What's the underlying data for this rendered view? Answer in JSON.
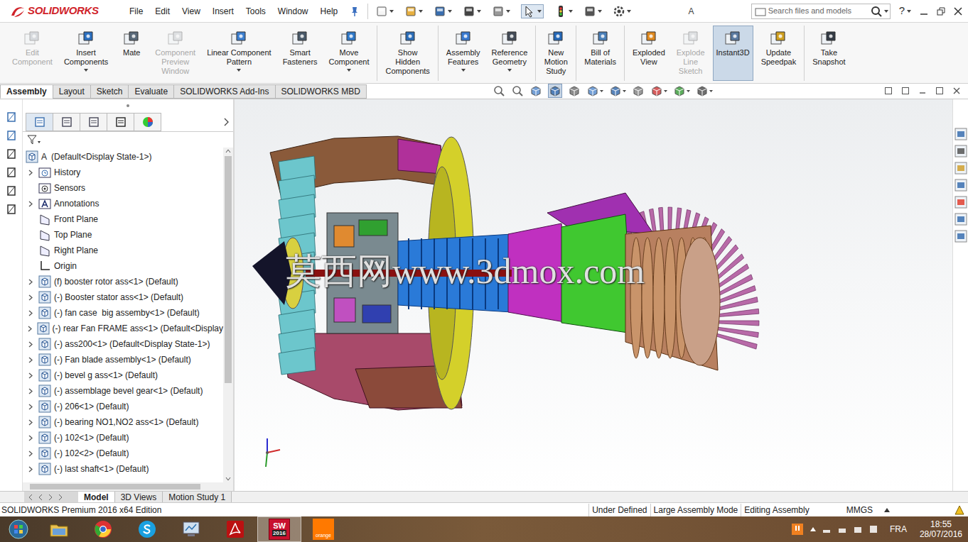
{
  "app": {
    "logo": "SOLIDWORKS",
    "document_title": "A",
    "help": "?"
  },
  "menu": [
    "File",
    "Edit",
    "View",
    "Insert",
    "Tools",
    "Window",
    "Help"
  ],
  "search": {
    "placeholder": "Search files and models"
  },
  "ribbon": [
    [
      {
        "lines": [
          "Edit",
          "Component"
        ],
        "disabled": true,
        "selected": false,
        "dropdown": false
      },
      {
        "lines": [
          "Insert",
          "Components"
        ],
        "disabled": false,
        "selected": false,
        "dropdown": true
      },
      {
        "lines": [
          "Mate"
        ],
        "disabled": false,
        "selected": false,
        "dropdown": false
      },
      {
        "lines": [
          "Component",
          "Preview",
          "Window"
        ],
        "disabled": true,
        "selected": false,
        "dropdown": false
      },
      {
        "lines": [
          "Linear Component",
          "Pattern"
        ],
        "disabled": false,
        "selected": false,
        "dropdown": true
      },
      {
        "lines": [
          "Smart",
          "Fasteners"
        ],
        "disabled": false,
        "selected": false,
        "dropdown": false
      },
      {
        "lines": [
          "Move",
          "Component"
        ],
        "disabled": false,
        "selected": false,
        "dropdown": true
      }
    ],
    [
      {
        "lines": [
          "Show",
          "Hidden",
          "Components"
        ],
        "disabled": false,
        "selected": false,
        "dropdown": false
      }
    ],
    [
      {
        "lines": [
          "Assembly",
          "Features"
        ],
        "disabled": false,
        "selected": false,
        "dropdown": true
      },
      {
        "lines": [
          "Reference",
          "Geometry"
        ],
        "disabled": false,
        "selected": false,
        "dropdown": true
      }
    ],
    [
      {
        "lines": [
          "New",
          "Motion",
          "Study"
        ],
        "disabled": false,
        "selected": false,
        "dropdown": false
      }
    ],
    [
      {
        "lines": [
          "Bill of",
          "Materials"
        ],
        "disabled": false,
        "selected": false,
        "dropdown": false
      }
    ],
    [
      {
        "lines": [
          "Exploded",
          "View"
        ],
        "disabled": false,
        "selected": false,
        "dropdown": false
      },
      {
        "lines": [
          "Explode",
          "Line",
          "Sketch"
        ],
        "disabled": true,
        "selected": false,
        "dropdown": false
      },
      {
        "lines": [
          "Instant3D"
        ],
        "disabled": false,
        "selected": true,
        "dropdown": false
      },
      {
        "lines": [
          "Update",
          "Speedpak"
        ],
        "disabled": false,
        "selected": false,
        "dropdown": false
      }
    ],
    [
      {
        "lines": [
          "Take",
          "Snapshot"
        ],
        "disabled": false,
        "selected": false,
        "dropdown": false
      }
    ]
  ],
  "command_tabs": [
    {
      "label": "Assembly",
      "selected": true
    },
    {
      "label": "Layout",
      "selected": false
    },
    {
      "label": "Sketch",
      "selected": false
    },
    {
      "label": "Evaluate",
      "selected": false
    },
    {
      "label": "SOLIDWORKS Add-Ins",
      "selected": false
    },
    {
      "label": "SOLIDWORKS MBD",
      "selected": false
    }
  ],
  "tree": {
    "root": "A  (Default<Display State-1>)",
    "items": [
      {
        "label": "History",
        "kind": "history",
        "expandable": true
      },
      {
        "label": "Sensors",
        "kind": "sensor",
        "expandable": false
      },
      {
        "label": "Annotations",
        "kind": "annotation",
        "expandable": true
      },
      {
        "label": "Front Plane",
        "kind": "plane",
        "expandable": false
      },
      {
        "label": "Top Plane",
        "kind": "plane",
        "expandable": false
      },
      {
        "label": "Right Plane",
        "kind": "plane",
        "expandable": false
      },
      {
        "label": "Origin",
        "kind": "origin",
        "expandable": false
      },
      {
        "label": "(f) booster rotor ass<1> (Default)",
        "kind": "assembly",
        "expandable": true
      },
      {
        "label": "(-) Booster stator ass<1> (Default)",
        "kind": "assembly",
        "expandable": true
      },
      {
        "label": "(-) fan case  big assemby<1> (Default)",
        "kind": "assembly",
        "expandable": true
      },
      {
        "label": "(-) rear Fan FRAME ass<1> (Default<Display",
        "kind": "assembly",
        "expandable": true
      },
      {
        "label": "(-) ass200<1> (Default<Display State-1>)",
        "kind": "assembly",
        "expandable": true
      },
      {
        "label": "(-) Fan blade assembly<1> (Default)",
        "kind": "assembly",
        "expandable": true
      },
      {
        "label": "(-) bevel g ass<1> (Default)",
        "kind": "assembly",
        "expandable": true
      },
      {
        "label": "(-) assemblage bevel gear<1> (Default)",
        "kind": "assembly",
        "expandable": true
      },
      {
        "label": "(-) 206<1> (Default)",
        "kind": "assembly",
        "expandable": true
      },
      {
        "label": "(-) bearing NO1,NO2 ass<1> (Default)",
        "kind": "assembly",
        "expandable": true
      },
      {
        "label": "(-) 102<1> (Default)",
        "kind": "assembly",
        "expandable": true
      },
      {
        "label": "(-) 102<2> (Default)",
        "kind": "assembly",
        "expandable": true
      },
      {
        "label": "(-) last shaft<1> (Default)",
        "kind": "assembly",
        "expandable": true
      }
    ]
  },
  "watermark": "莫西网www.3dmox.com",
  "bottom_tabs": [
    {
      "label": "Model",
      "selected": true
    },
    {
      "label": "3D Views",
      "selected": false
    },
    {
      "label": "Motion Study 1",
      "selected": false
    }
  ],
  "status_bar": {
    "edition": "SOLIDWORKS Premium 2016 x64 Edition",
    "items": [
      "Under Defined",
      "Large Assembly Mode",
      "Editing Assembly"
    ],
    "units": "MMGS"
  },
  "taskbar": {
    "apps": [
      {
        "kind": "explorer",
        "lines": [],
        "selected": false
      },
      {
        "kind": "chrome",
        "lines": [],
        "selected": false
      },
      {
        "kind": "skype",
        "lines": [],
        "selected": false
      },
      {
        "kind": "monitor",
        "lines": [],
        "selected": false
      },
      {
        "kind": "acrobat",
        "lines": [],
        "selected": false
      },
      {
        "kind": "solidworks",
        "lines": [
          "SW",
          "2016"
        ],
        "selected": true
      },
      {
        "kind": "orange",
        "lines": [
          "orange"
        ],
        "selected": false
      }
    ],
    "language": "FRA",
    "time": "18:55",
    "date": "28/07/2016"
  }
}
